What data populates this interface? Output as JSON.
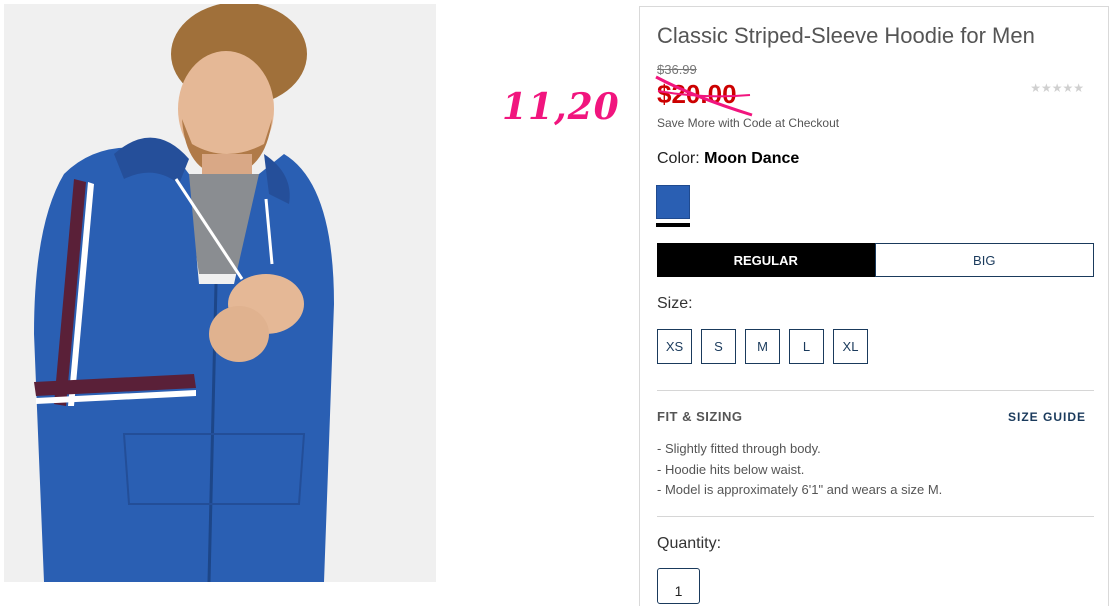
{
  "product": {
    "title": "Classic Striped-Sleeve Hoodie for Men",
    "original_price": "$36.99",
    "sale_price": "$20.00",
    "rating_stars": "★★★★★",
    "promo_text": "Save More with Code at Checkout",
    "color_label": "Color:",
    "color_value": "Moon Dance",
    "swatch_color": "#2a5fb3",
    "fit_options": [
      "REGULAR",
      "BIG"
    ],
    "fit_selected": "REGULAR",
    "size_label": "Size:",
    "sizes": [
      "XS",
      "S",
      "M",
      "L",
      "XL"
    ],
    "fit_sizing_title": "FIT & SIZING",
    "size_guide_label": "SIZE GUIDE",
    "fit_bullets": [
      "-  Slightly fitted through body.",
      "-  Hoodie hits below waist.",
      "-  Model is approximately 6'1\" and wears a size M."
    ],
    "quantity_label": "Quantity:",
    "quantity_value": "1"
  },
  "annotation": {
    "handwritten_price": "11,20",
    "color": "#f1157e"
  },
  "colors": {
    "sale_red": "#cc0000",
    "navy": "#1a3a5c",
    "hoodie_blue": "#2a5fb3"
  }
}
